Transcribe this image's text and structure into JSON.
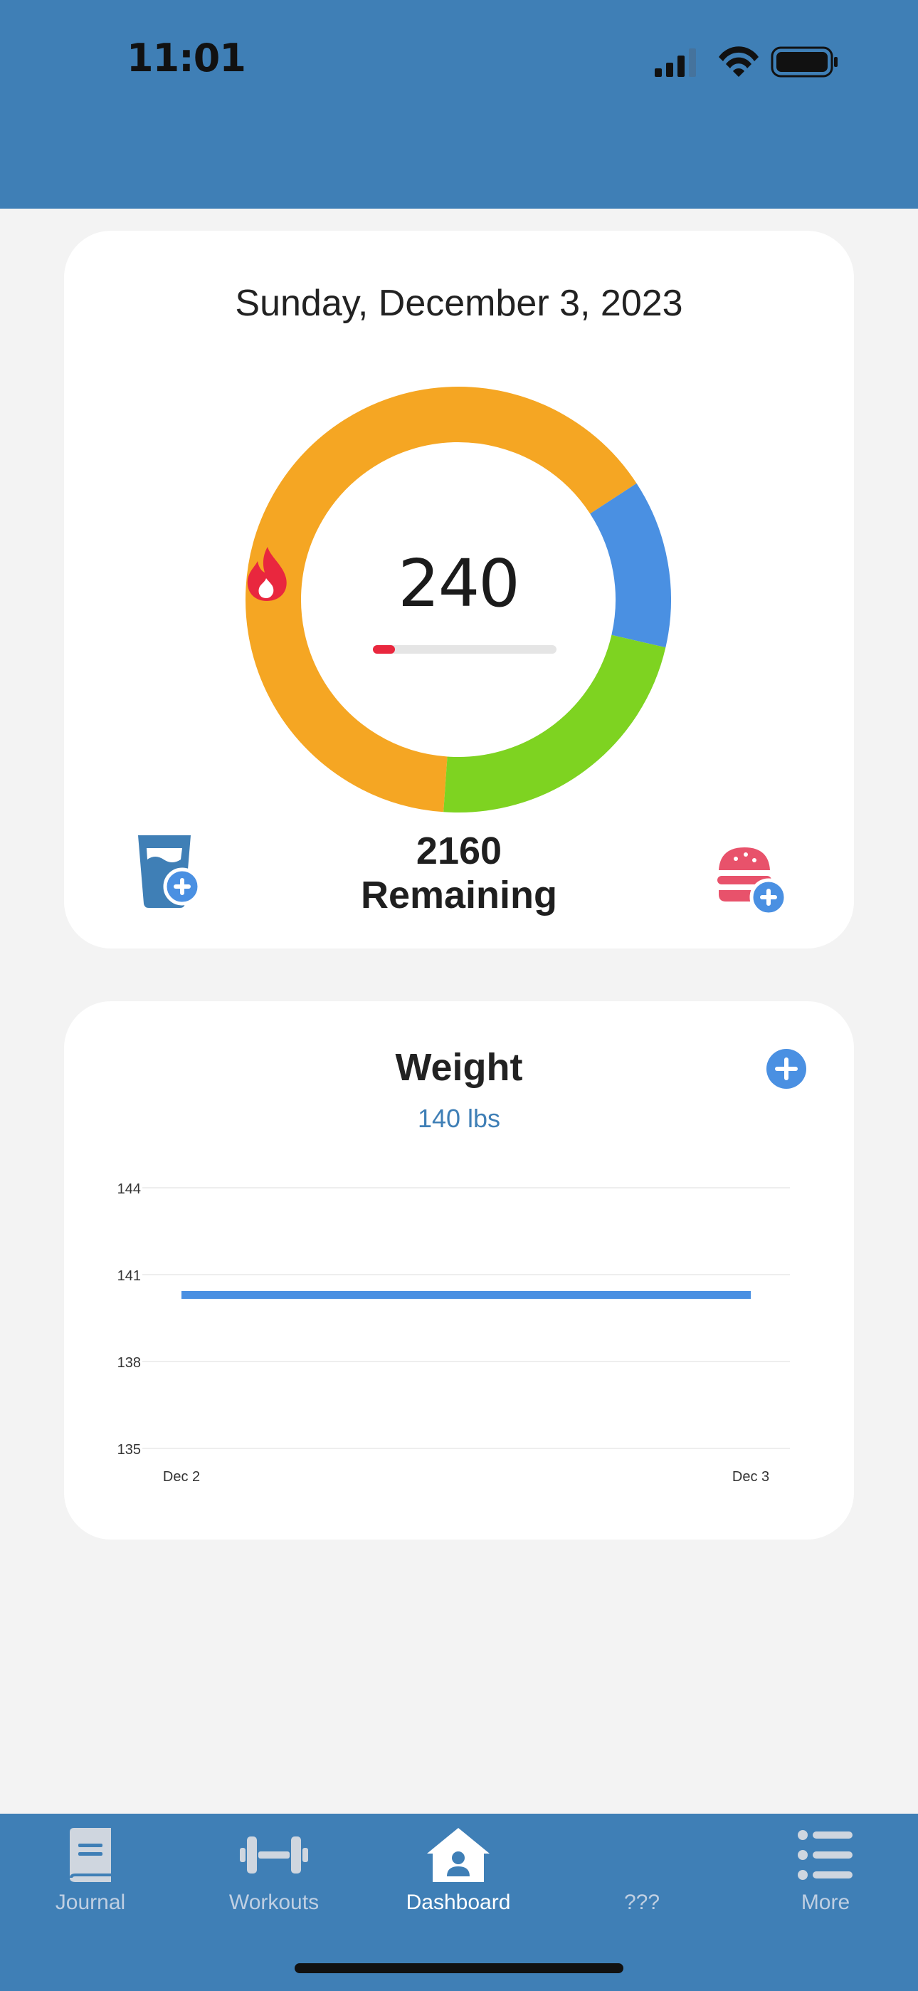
{
  "status_bar": {
    "time": "11:01"
  },
  "summary": {
    "date": "Sunday, December 3, 2023",
    "calories_burned": "240",
    "remaining_number": "2160",
    "remaining_label": "Remaining",
    "burn_progress": 0.12,
    "ring_segments": [
      {
        "name": "orange",
        "color": "#f5a623",
        "fraction": 0.647
      },
      {
        "name": "blue",
        "color": "#4a90e2",
        "fraction": 0.128
      },
      {
        "name": "green",
        "color": "#7ed321",
        "fraction": 0.225
      }
    ],
    "icons": {
      "water": "water-glass-plus-icon",
      "food": "burger-plus-icon",
      "flame": "flame-icon"
    }
  },
  "weight": {
    "title": "Weight",
    "current_value": "140 lbs",
    "add_icon": "plus-circle-icon",
    "chart_data": {
      "type": "line",
      "x": [
        "Dec 2",
        "Dec 3"
      ],
      "series": [
        {
          "values": [
            140.3,
            140.3
          ]
        }
      ],
      "y_ticks": [
        "144",
        "141",
        "138",
        "135"
      ],
      "ylim": [
        135,
        144
      ],
      "grid": true,
      "line_color": "#4a90e2"
    }
  },
  "tab_bar": {
    "tabs": [
      {
        "label": "Journal",
        "icon": "book-icon",
        "active": false
      },
      {
        "label": "Workouts",
        "icon": "dumbbell-icon",
        "active": false
      },
      {
        "label": "Dashboard",
        "icon": "home-icon",
        "active": true
      },
      {
        "label": "???",
        "icon": "",
        "active": false
      },
      {
        "label": "More",
        "icon": "list-icon",
        "active": false
      }
    ]
  },
  "colors": {
    "header": "#3f7fb6",
    "background": "#f3f3f3",
    "accent_red": "#e9273e",
    "accent_blue": "#4a90e2"
  }
}
